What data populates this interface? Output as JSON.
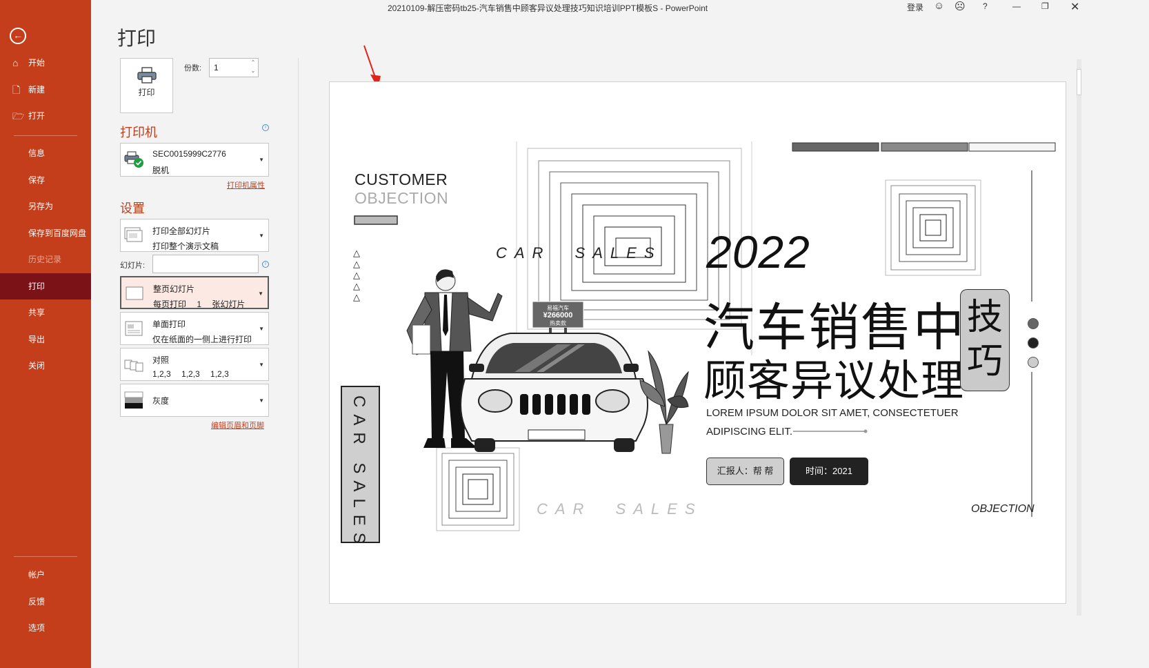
{
  "window": {
    "title": "20210109-解压密码tb25-汽车销售中顾客异议处理技巧知识培训PPT模板S  -  PowerPoint",
    "signin": "登录",
    "help": "?"
  },
  "sidebar": {
    "items": [
      {
        "label": "开始",
        "icon": "home-icon"
      },
      {
        "label": "新建",
        "icon": "new-file-icon"
      },
      {
        "label": "打开",
        "icon": "open-folder-icon"
      },
      {
        "label": "信息"
      },
      {
        "label": "保存"
      },
      {
        "label": "另存为"
      },
      {
        "label": "保存到百度网盘"
      },
      {
        "label": "历史记录"
      },
      {
        "label": "打印"
      },
      {
        "label": "共享"
      },
      {
        "label": "导出"
      },
      {
        "label": "关闭"
      }
    ],
    "bottom": [
      {
        "label": "帐户"
      },
      {
        "label": "反馈"
      },
      {
        "label": "选项"
      }
    ]
  },
  "print": {
    "heading": "打印",
    "button_label": "打印",
    "copies_label": "份数:",
    "copies_value": "1",
    "printer_section": "打印机",
    "printer_name": "SEC0015999C2776",
    "printer_status": "脱机",
    "printer_props": "打印机属性",
    "settings_section": "设置",
    "slides_label": "幻灯片:",
    "dropdowns": [
      {
        "l1": "打印全部幻灯片",
        "l2": "打印整个演示文稿"
      },
      {
        "l1": "整页幻灯片",
        "l2": "每页打印 1 张幻灯片"
      },
      {
        "l1": "单面打印",
        "l2": "仅在纸面的一侧上进行打印"
      },
      {
        "l1": "对照",
        "l2": "1,2,3 1,2,3 1,2,3"
      },
      {
        "l1": "灰度",
        "l2": ""
      }
    ],
    "edit_header_footer": "编辑页眉和页脚"
  },
  "slide": {
    "customer": "CUSTOMER",
    "objection": "OBJECTION",
    "year": "2022",
    "title1": "汽车销售中",
    "title2": "顾客异议处理",
    "tag1": "技",
    "tag2": "巧",
    "lorem": "LOREM IPSUM DOLOR SIT AMET, CONSECTETUER ADIPISCING ELIT.",
    "reporter": "汇报人：帮 帮",
    "time": "时间：2021",
    "car_sales": "CAR SALES",
    "objection_italic": "OBJECTION",
    "sign_line1": "易福汽车",
    "sign_price": "¥266000",
    "sign_tag": "热卖款"
  }
}
